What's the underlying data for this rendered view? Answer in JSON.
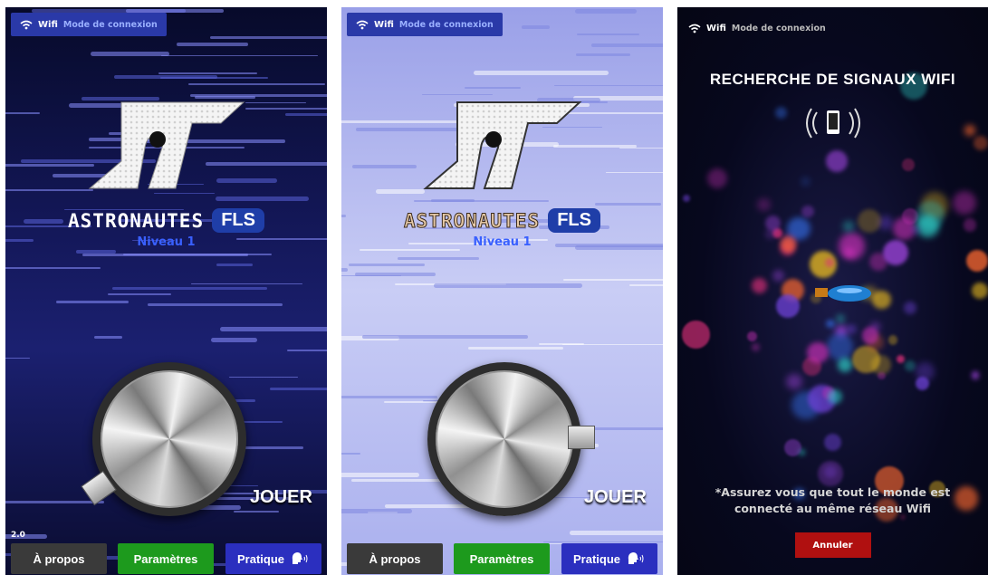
{
  "screens": [
    {
      "theme": "dark",
      "wifi": {
        "label": "Wifi",
        "sub": "Mode de connexion"
      },
      "title": "ASTRONAUTES",
      "badge": "FLS",
      "level": "Niveau 1",
      "play": "JOUER",
      "version": "2.0",
      "buttons": {
        "about": "À propos",
        "settings": "Paramètres",
        "practice": "Pratique"
      }
    },
    {
      "theme": "light",
      "wifi": {
        "label": "Wifi",
        "sub": "Mode de connexion"
      },
      "title": "ASTRONAUTES",
      "badge": "FLS",
      "level": "Niveau 1",
      "play": "JOUER",
      "buttons": {
        "about": "À propos",
        "settings": "Paramètres",
        "practice": "Pratique"
      }
    },
    {
      "theme": "space",
      "wifi": {
        "label": "Wifi",
        "sub": "Mode de connexion"
      },
      "heading": "RECHERCHE DE SIGNAUX WIFI",
      "note_line1": "*Assurez vous que tout le monde est",
      "note_line2": "connecté au même réseau Wifi",
      "cancel": "Annuler"
    }
  ],
  "colors": {
    "accent": "#2a39a8",
    "badge": "#1f3ea8",
    "level": "#3960ff",
    "settings": "#1d9a1d",
    "cancel": "#b01010"
  },
  "icons": [
    "wifi-icon",
    "logo-icon",
    "speaking-head-icon",
    "phone-signal-icon",
    "rocket-icon"
  ]
}
